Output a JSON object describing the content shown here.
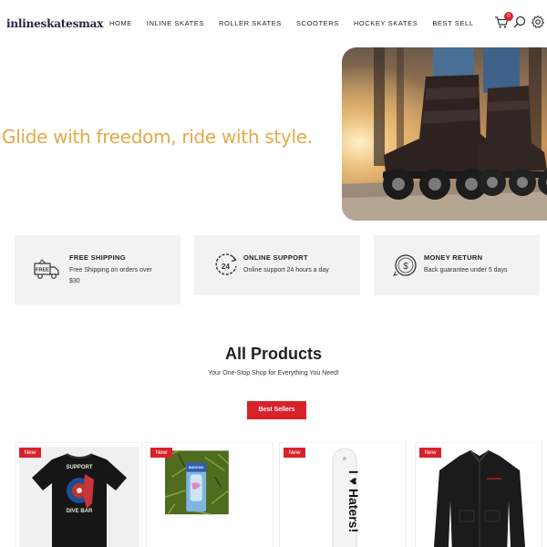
{
  "header": {
    "logo": "inlineskatesmax",
    "nav": [
      "HOME",
      "INLINE SKATES",
      "ROLLER SKATES",
      "SCOOTERS",
      "HOCKEY SKATES",
      "BEST SELL"
    ],
    "cart_count": "0",
    "icons": [
      "cart-icon",
      "search-icon",
      "gear-icon"
    ]
  },
  "hero": {
    "tagline": "Glide with freedom, ride with style.",
    "tagline_color": "#e1aa47"
  },
  "features": [
    {
      "title": "FREE SHIPPING",
      "text": "Free Shipping on orders over $30",
      "icon": "free-delivery-truck-icon"
    },
    {
      "title": "ONLINE SUPPORT",
      "text": "Online support 24 hours a day",
      "icon": "24-hour-support-icon"
    },
    {
      "title": "MONEY RETURN",
      "text": "Back guarantee under 5 days",
      "icon": "money-return-icon"
    }
  ],
  "products": {
    "title": "All Products",
    "subtitle": "Your One-Stop Shop for Everything You Need!",
    "button_label": "Best Sellers",
    "badge_label": "New",
    "cards": [
      {
        "badge": "New",
        "shirt_print_top": "SUPPORT",
        "shirt_print_bottom": "DIVE BAR"
      },
      {
        "badge": "New",
        "package_text": "BUDOGO"
      },
      {
        "badge": "New",
        "deck_text": "I ♥ Haters!"
      },
      {
        "badge": "New"
      }
    ]
  },
  "colors": {
    "accent": "#d8222a",
    "feature_bg": "#f2f2f3",
    "logo": "#2b2440"
  }
}
